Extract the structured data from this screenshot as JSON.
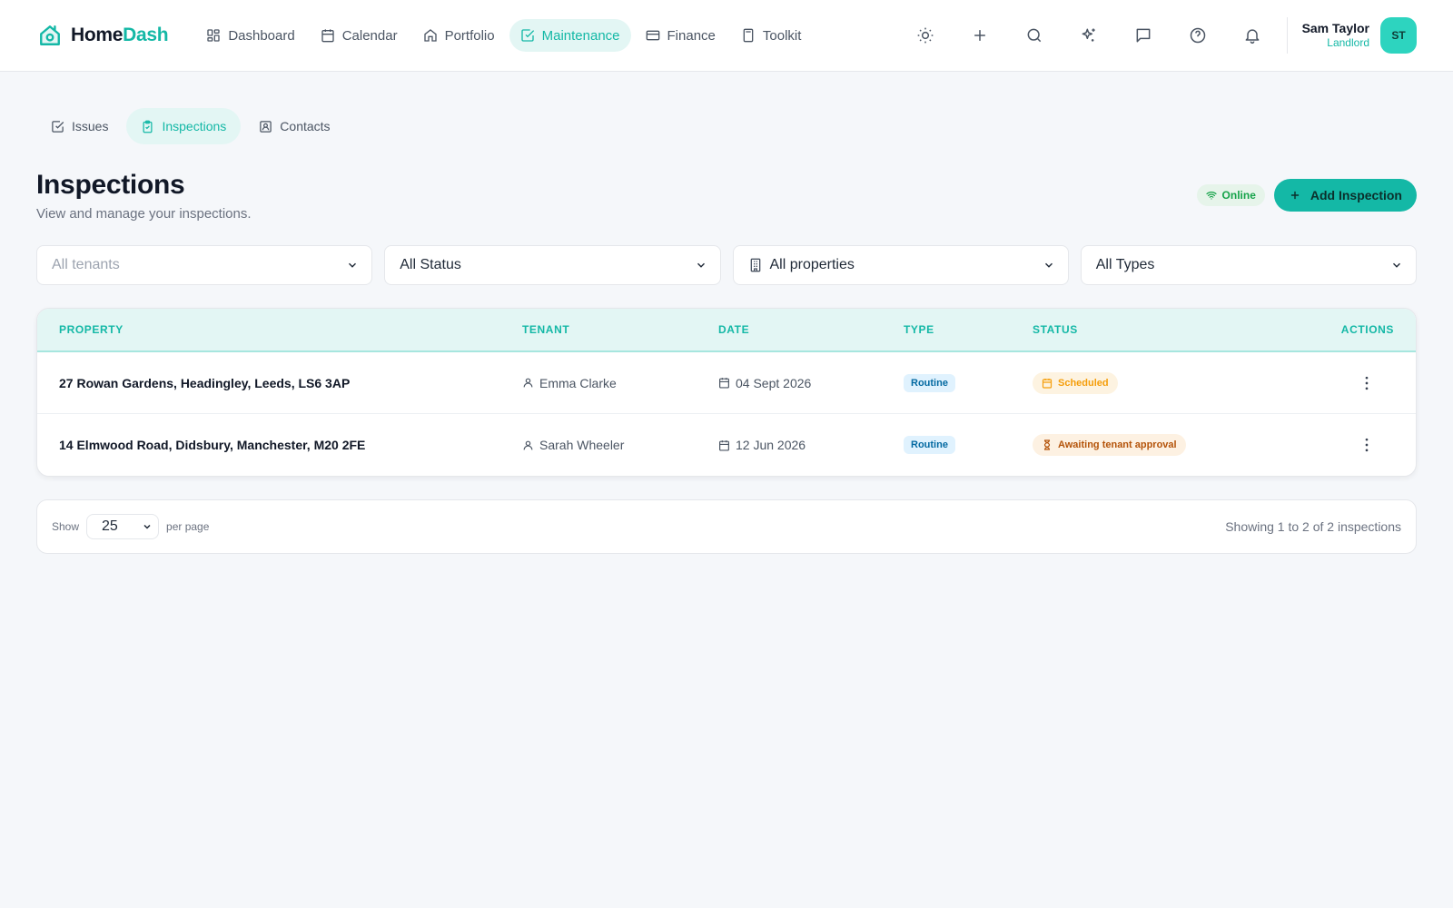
{
  "brand": {
    "name_part1": "Home",
    "name_part2": "Dash",
    "logo_icon": "house-icon"
  },
  "nav": {
    "items": [
      {
        "label": "Dashboard",
        "icon": "grid-icon"
      },
      {
        "label": "Calendar",
        "icon": "calendar-icon"
      },
      {
        "label": "Portfolio",
        "icon": "home-icon"
      },
      {
        "label": "Maintenance",
        "icon": "check-square-icon",
        "active": true
      },
      {
        "label": "Finance",
        "icon": "card-icon"
      },
      {
        "label": "Toolkit",
        "icon": "calculator-icon"
      }
    ]
  },
  "top_actions": [
    "sun-icon",
    "plus-icon",
    "search-icon",
    "sparkles-icon",
    "message-icon",
    "help-icon",
    "bell-icon"
  ],
  "user": {
    "name": "Sam Taylor",
    "role": "Landlord",
    "initials": "ST"
  },
  "subtabs": [
    {
      "label": "Issues",
      "icon": "check-square-icon"
    },
    {
      "label": "Inspections",
      "icon": "clipboard-icon",
      "active": true
    },
    {
      "label": "Contacts",
      "icon": "contact-icon"
    }
  ],
  "page": {
    "title": "Inspections",
    "subtitle": "View and manage your inspections.",
    "online_label": "Online",
    "add_button": "Add Inspection"
  },
  "filters": {
    "tenants": "All tenants",
    "status": "All Status",
    "properties": "All properties",
    "types": "All Types"
  },
  "table": {
    "headers": [
      "PROPERTY",
      "TENANT",
      "DATE",
      "TYPE",
      "STATUS",
      "ACTIONS"
    ],
    "rows": [
      {
        "property": "27 Rowan Gardens, Headingley, Leeds, LS6 3AP",
        "tenant": "Emma Clarke",
        "date": "04 Sept 2026",
        "type": "Routine",
        "status": "Scheduled"
      },
      {
        "property": "14 Elmwood Road, Didsbury, Manchester, M20 2FE",
        "tenant": "Sarah Wheeler",
        "date": "12 Jun 2026",
        "type": "Routine",
        "status": "Awaiting tenant approval"
      }
    ]
  },
  "pager": {
    "show_label": "Show",
    "per_page_value": "25",
    "per_page_label": "per page",
    "info": "Showing 1 to 2 of 2 inspections"
  },
  "colors": {
    "accent": "#14b8a6",
    "accent_light": "#e3f6f4",
    "scheduled": "#f59e0b",
    "awaiting": "#b45309",
    "online": "#16a34a"
  }
}
